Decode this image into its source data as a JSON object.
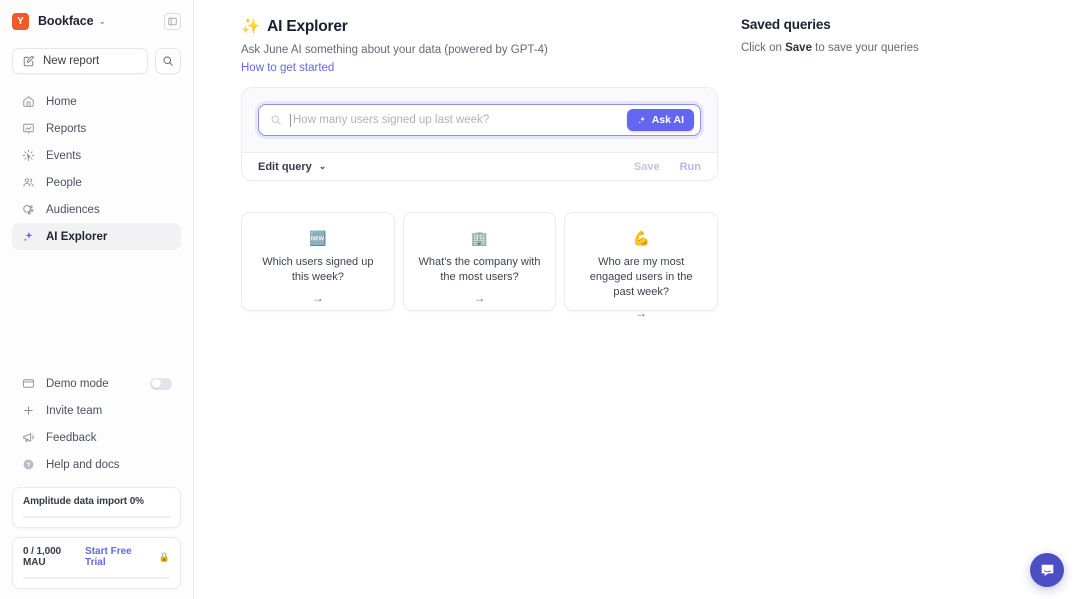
{
  "workspace": {
    "logo_letter": "Y",
    "name": "Bookface",
    "caret": "⌄",
    "collapse_icon": "sidebar-collapse-icon"
  },
  "sidebar": {
    "new_report_label": "New report",
    "search_icon": "search-icon",
    "nav": [
      {
        "label": "Home",
        "icon": "home-icon",
        "active": false
      },
      {
        "label": "Reports",
        "icon": "reports-icon",
        "active": false
      },
      {
        "label": "Events",
        "icon": "events-icon",
        "active": false
      },
      {
        "label": "People",
        "icon": "people-icon",
        "active": false
      },
      {
        "label": "Audiences",
        "icon": "audiences-icon",
        "active": false
      },
      {
        "label": "AI Explorer",
        "icon": "sparkle-icon",
        "active": true
      }
    ],
    "bottom": [
      {
        "label": "Demo mode",
        "icon": "window-icon",
        "toggle": true,
        "toggle_on": false
      },
      {
        "label": "Invite team",
        "icon": "plus-icon",
        "toggle": false
      },
      {
        "label": "Feedback",
        "icon": "megaphone-icon",
        "toggle": false
      },
      {
        "label": "Help and docs",
        "icon": "help-circle-icon",
        "toggle": false
      }
    ],
    "import_card": {
      "label": "Amplitude data import 0%",
      "progress_percent": 0
    },
    "mau_card": {
      "label": "0 / 1,000 MAU",
      "link": "Start Free Trial",
      "lock_icon": "🔒",
      "progress_percent": 0
    }
  },
  "explorer": {
    "emoji": "✨",
    "title": "AI Explorer",
    "subtitle": "Ask June AI something about your data (powered by GPT-4)",
    "link": "How to get started"
  },
  "query": {
    "placeholder": "How many users signed up last week?",
    "value": "",
    "search_icon": "search-icon",
    "ask_button": "Ask AI",
    "ask_icon": "sparkle-icon",
    "edit_query_label": "Edit query",
    "edit_caret": "⌄",
    "save_label": "Save",
    "run_label": "Run"
  },
  "suggestions": [
    {
      "emoji": "🆕",
      "text": "Which users signed up this week?",
      "arrow": "→"
    },
    {
      "emoji": "🏢",
      "text": "What's the company with the most users?",
      "arrow": "→"
    },
    {
      "emoji": "💪",
      "text": "Who are my most engaged users in the past week?",
      "arrow": "→"
    }
  ],
  "saved_queries": {
    "title": "Saved queries",
    "hint_prefix": "Click on ",
    "hint_bold": "Save",
    "hint_suffix": " to save your queries"
  },
  "intercom": {
    "icon": "chat-bubble-icon"
  },
  "colors": {
    "accent": "#6366f1",
    "brand_logo": "#f05a28",
    "intercom": "#4a4fc4",
    "text_primary": "#1b2030",
    "text_muted": "#636a78"
  }
}
